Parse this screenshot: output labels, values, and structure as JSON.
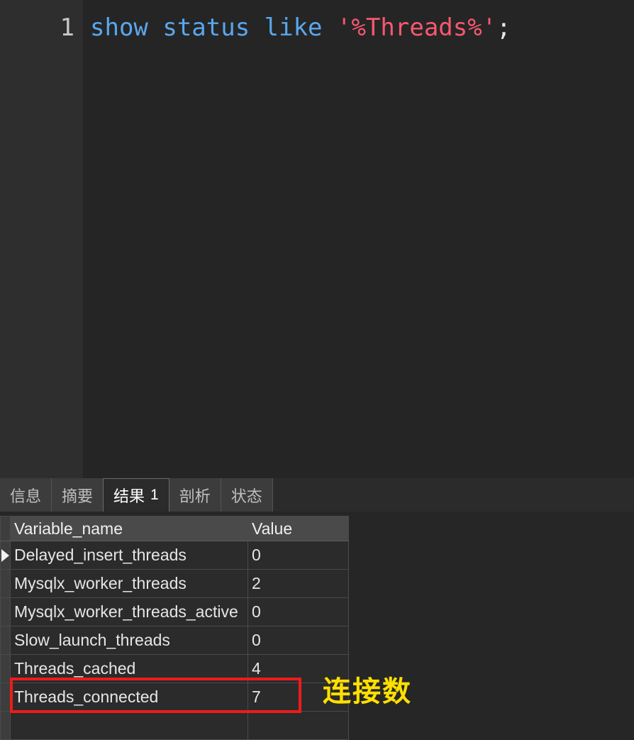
{
  "editor": {
    "line_number": "1",
    "query_tokens": [
      {
        "text": "show status like",
        "type": "keyword"
      },
      {
        "text": " ",
        "type": "plain"
      },
      {
        "text": "'%Threads%'",
        "type": "string"
      },
      {
        "text": ";",
        "type": "punct"
      }
    ],
    "query_text": "show status like '%Threads%';",
    "colors": {
      "background": "#252526",
      "gutter": "#2e2e2e",
      "keyword": "#5aa7ec",
      "string": "#f8586f",
      "punctuation": "#e8e8e8",
      "line_number": "#c8c8c8"
    }
  },
  "result_panel": {
    "tabs": [
      {
        "label": "信息",
        "count": "",
        "active": false
      },
      {
        "label": "摘要",
        "count": "",
        "active": false
      },
      {
        "label": "结果",
        "count": "1",
        "active": true
      },
      {
        "label": "剖析",
        "count": "",
        "active": false
      },
      {
        "label": "状态",
        "count": "",
        "active": false
      }
    ],
    "grid": {
      "columns": [
        "Variable_name",
        "Value"
      ],
      "rows": [
        {
          "variable_name": "Delayed_insert_threads",
          "value": "0",
          "selected": true
        },
        {
          "variable_name": "Mysqlx_worker_threads",
          "value": "2",
          "selected": false
        },
        {
          "variable_name": "Mysqlx_worker_threads_active",
          "value": "0",
          "selected": false
        },
        {
          "variable_name": "Slow_launch_threads",
          "value": "0",
          "selected": false
        },
        {
          "variable_name": "Threads_cached",
          "value": "4",
          "selected": false
        },
        {
          "variable_name": "Threads_connected",
          "value": "7",
          "selected": false
        }
      ]
    }
  },
  "annotations": {
    "highlight_box": {
      "color": "#ee1b1b",
      "target_row": "Threads_connected"
    },
    "note_text": "连接数",
    "note_color": "#ffe000"
  }
}
